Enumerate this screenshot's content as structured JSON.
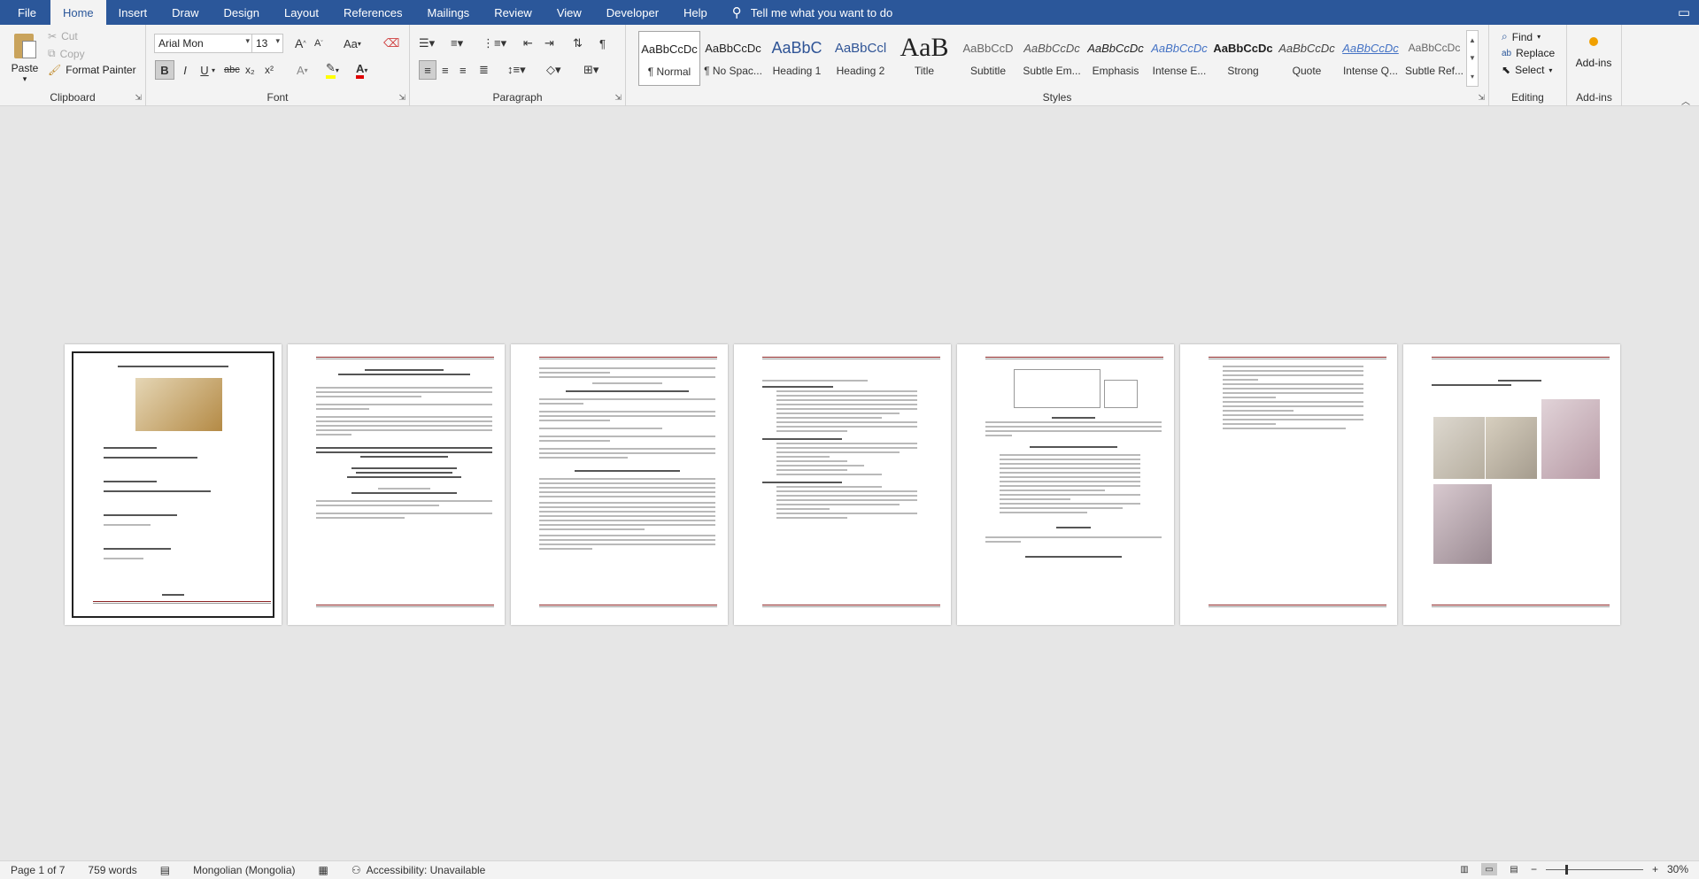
{
  "menu": {
    "file": "File",
    "tabs": [
      "Home",
      "Insert",
      "Draw",
      "Design",
      "Layout",
      "References",
      "Mailings",
      "Review",
      "View",
      "Developer",
      "Help"
    ],
    "active_tab": "Home",
    "tell_me": "Tell me what you want to do"
  },
  "clipboard": {
    "paste": "Paste",
    "cut": "Cut",
    "copy": "Copy",
    "format_painter": "Format Painter",
    "label": "Clipboard"
  },
  "font": {
    "name": "Arial Mon",
    "size": "13",
    "label": "Font",
    "bold": "B",
    "italic": "I",
    "underline": "U",
    "strike": "abc",
    "subscript": "x₂",
    "superscript": "x²",
    "grow": "A",
    "shrink": "A",
    "case": "Aa",
    "effects": "A",
    "highlight_color": "#ffff00",
    "font_color": "#e00000"
  },
  "paragraph": {
    "label": "Paragraph"
  },
  "styles": {
    "label": "Styles",
    "items": [
      {
        "sample": "AaBbCcDc",
        "name": "¶ Normal"
      },
      {
        "sample": "AaBbCcDc",
        "name": "¶ No Spac..."
      },
      {
        "sample": "AaBbC",
        "name": "Heading 1"
      },
      {
        "sample": "AaBbCcl",
        "name": "Heading 2"
      },
      {
        "sample": "AaB",
        "name": "Title"
      },
      {
        "sample": "AaBbCcD",
        "name": "Subtitle"
      },
      {
        "sample": "AaBbCcDc",
        "name": "Subtle Em..."
      },
      {
        "sample": "AaBbCcDc",
        "name": "Emphasis"
      },
      {
        "sample": "AaBbCcDc",
        "name": "Intense E..."
      },
      {
        "sample": "AaBbCcDc",
        "name": "Strong"
      },
      {
        "sample": "AaBbCcDc",
        "name": "Quote"
      },
      {
        "sample": "AaBbCcDc",
        "name": "Intense Q..."
      },
      {
        "sample": "AaBbCcDc",
        "name": "Subtle Ref..."
      }
    ]
  },
  "editing": {
    "label": "Editing",
    "find": "Find",
    "replace": "Replace",
    "select": "Select"
  },
  "addins": {
    "button": "Add-ins",
    "label": "Add-ins"
  },
  "status": {
    "page": "Page 1 of 7",
    "words": "759 words",
    "language": "Mongolian (Mongolia)",
    "accessibility": "Accessibility: Unavailable",
    "zoom": "30%",
    "zoom_minus": "−",
    "zoom_plus": "+"
  },
  "pages": [
    {
      "title": "............ аймгийн ............ сум",
      "year": "2013 он"
    },
    {
      "title": "............ аймгийн ............ сумын"
    },
    {
      "title": "Гэр угаалгуур болон шүршүүрийн тохижилт"
    },
    {
      "title": "Эрүүл ахуйн шаардлага"
    },
    {
      "title": "ТЕСЛИЙН ЗОРИЛГО"
    },
    {
      "title": ""
    },
    {
      "title": "ХАВСРАЛТ ЗУРАГ"
    }
  ]
}
